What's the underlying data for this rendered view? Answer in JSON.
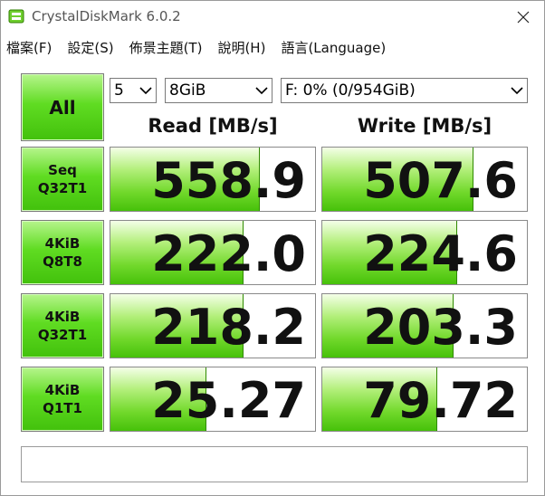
{
  "window": {
    "title": "CrystalDiskMark 6.0.2"
  },
  "menu": [
    {
      "label": "檔案(F)"
    },
    {
      "label": "設定(S)"
    },
    {
      "label": "佈景主題(T)"
    },
    {
      "label": "說明(H)"
    },
    {
      "label": "語言(Language)"
    }
  ],
  "controls": {
    "all_label": "All",
    "count_value": "5",
    "size_value": "8GiB",
    "drive_value": "F: 0% (0/954GiB)"
  },
  "headers": {
    "read": "Read [MB/s]",
    "write": "Write [MB/s]"
  },
  "tests": [
    {
      "line1": "Seq",
      "line2": "Q32T1",
      "read": "558.9",
      "write": "507.6",
      "read_fill": 0.73,
      "write_fill": 0.74
    },
    {
      "line1": "4KiB",
      "line2": "Q8T8",
      "read": "222.0",
      "write": "224.6",
      "read_fill": 0.65,
      "write_fill": 0.66
    },
    {
      "line1": "4KiB",
      "line2": "Q32T1",
      "read": "218.2",
      "write": "203.3",
      "read_fill": 0.65,
      "write_fill": 0.64
    },
    {
      "line1": "4KiB",
      "line2": "Q1T1",
      "read": "25.27",
      "write": "79.72",
      "read_fill": 0.47,
      "write_fill": 0.56
    }
  ],
  "status": {
    "text": ""
  },
  "colors": {
    "accent_green": "#4cc414",
    "border": "#8a8a8a"
  },
  "icons": {
    "app": "disk-icon",
    "close": "close-icon",
    "dropdown": "chevron-down-icon"
  }
}
